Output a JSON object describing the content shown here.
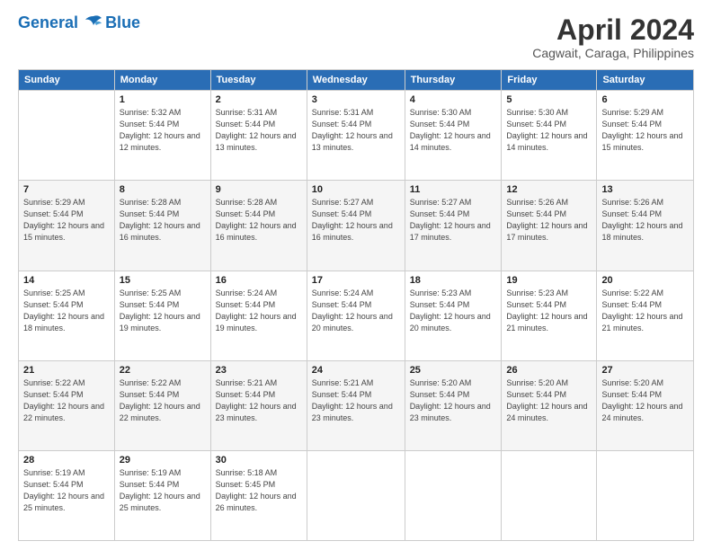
{
  "header": {
    "logo_line1": "General",
    "logo_line2": "Blue",
    "month": "April 2024",
    "location": "Cagwait, Caraga, Philippines"
  },
  "columns": [
    "Sunday",
    "Monday",
    "Tuesday",
    "Wednesday",
    "Thursday",
    "Friday",
    "Saturday"
  ],
  "weeks": [
    [
      {
        "day": "",
        "sunrise": "",
        "sunset": "",
        "daylight": ""
      },
      {
        "day": "1",
        "sunrise": "Sunrise: 5:32 AM",
        "sunset": "Sunset: 5:44 PM",
        "daylight": "Daylight: 12 hours and 12 minutes."
      },
      {
        "day": "2",
        "sunrise": "Sunrise: 5:31 AM",
        "sunset": "Sunset: 5:44 PM",
        "daylight": "Daylight: 12 hours and 13 minutes."
      },
      {
        "day": "3",
        "sunrise": "Sunrise: 5:31 AM",
        "sunset": "Sunset: 5:44 PM",
        "daylight": "Daylight: 12 hours and 13 minutes."
      },
      {
        "day": "4",
        "sunrise": "Sunrise: 5:30 AM",
        "sunset": "Sunset: 5:44 PM",
        "daylight": "Daylight: 12 hours and 14 minutes."
      },
      {
        "day": "5",
        "sunrise": "Sunrise: 5:30 AM",
        "sunset": "Sunset: 5:44 PM",
        "daylight": "Daylight: 12 hours and 14 minutes."
      },
      {
        "day": "6",
        "sunrise": "Sunrise: 5:29 AM",
        "sunset": "Sunset: 5:44 PM",
        "daylight": "Daylight: 12 hours and 15 minutes."
      }
    ],
    [
      {
        "day": "7",
        "sunrise": "Sunrise: 5:29 AM",
        "sunset": "Sunset: 5:44 PM",
        "daylight": "Daylight: 12 hours and 15 minutes."
      },
      {
        "day": "8",
        "sunrise": "Sunrise: 5:28 AM",
        "sunset": "Sunset: 5:44 PM",
        "daylight": "Daylight: 12 hours and 16 minutes."
      },
      {
        "day": "9",
        "sunrise": "Sunrise: 5:28 AM",
        "sunset": "Sunset: 5:44 PM",
        "daylight": "Daylight: 12 hours and 16 minutes."
      },
      {
        "day": "10",
        "sunrise": "Sunrise: 5:27 AM",
        "sunset": "Sunset: 5:44 PM",
        "daylight": "Daylight: 12 hours and 16 minutes."
      },
      {
        "day": "11",
        "sunrise": "Sunrise: 5:27 AM",
        "sunset": "Sunset: 5:44 PM",
        "daylight": "Daylight: 12 hours and 17 minutes."
      },
      {
        "day": "12",
        "sunrise": "Sunrise: 5:26 AM",
        "sunset": "Sunset: 5:44 PM",
        "daylight": "Daylight: 12 hours and 17 minutes."
      },
      {
        "day": "13",
        "sunrise": "Sunrise: 5:26 AM",
        "sunset": "Sunset: 5:44 PM",
        "daylight": "Daylight: 12 hours and 18 minutes."
      }
    ],
    [
      {
        "day": "14",
        "sunrise": "Sunrise: 5:25 AM",
        "sunset": "Sunset: 5:44 PM",
        "daylight": "Daylight: 12 hours and 18 minutes."
      },
      {
        "day": "15",
        "sunrise": "Sunrise: 5:25 AM",
        "sunset": "Sunset: 5:44 PM",
        "daylight": "Daylight: 12 hours and 19 minutes."
      },
      {
        "day": "16",
        "sunrise": "Sunrise: 5:24 AM",
        "sunset": "Sunset: 5:44 PM",
        "daylight": "Daylight: 12 hours and 19 minutes."
      },
      {
        "day": "17",
        "sunrise": "Sunrise: 5:24 AM",
        "sunset": "Sunset: 5:44 PM",
        "daylight": "Daylight: 12 hours and 20 minutes."
      },
      {
        "day": "18",
        "sunrise": "Sunrise: 5:23 AM",
        "sunset": "Sunset: 5:44 PM",
        "daylight": "Daylight: 12 hours and 20 minutes."
      },
      {
        "day": "19",
        "sunrise": "Sunrise: 5:23 AM",
        "sunset": "Sunset: 5:44 PM",
        "daylight": "Daylight: 12 hours and 21 minutes."
      },
      {
        "day": "20",
        "sunrise": "Sunrise: 5:22 AM",
        "sunset": "Sunset: 5:44 PM",
        "daylight": "Daylight: 12 hours and 21 minutes."
      }
    ],
    [
      {
        "day": "21",
        "sunrise": "Sunrise: 5:22 AM",
        "sunset": "Sunset: 5:44 PM",
        "daylight": "Daylight: 12 hours and 22 minutes."
      },
      {
        "day": "22",
        "sunrise": "Sunrise: 5:22 AM",
        "sunset": "Sunset: 5:44 PM",
        "daylight": "Daylight: 12 hours and 22 minutes."
      },
      {
        "day": "23",
        "sunrise": "Sunrise: 5:21 AM",
        "sunset": "Sunset: 5:44 PM",
        "daylight": "Daylight: 12 hours and 23 minutes."
      },
      {
        "day": "24",
        "sunrise": "Sunrise: 5:21 AM",
        "sunset": "Sunset: 5:44 PM",
        "daylight": "Daylight: 12 hours and 23 minutes."
      },
      {
        "day": "25",
        "sunrise": "Sunrise: 5:20 AM",
        "sunset": "Sunset: 5:44 PM",
        "daylight": "Daylight: 12 hours and 23 minutes."
      },
      {
        "day": "26",
        "sunrise": "Sunrise: 5:20 AM",
        "sunset": "Sunset: 5:44 PM",
        "daylight": "Daylight: 12 hours and 24 minutes."
      },
      {
        "day": "27",
        "sunrise": "Sunrise: 5:20 AM",
        "sunset": "Sunset: 5:44 PM",
        "daylight": "Daylight: 12 hours and 24 minutes."
      }
    ],
    [
      {
        "day": "28",
        "sunrise": "Sunrise: 5:19 AM",
        "sunset": "Sunset: 5:44 PM",
        "daylight": "Daylight: 12 hours and 25 minutes."
      },
      {
        "day": "29",
        "sunrise": "Sunrise: 5:19 AM",
        "sunset": "Sunset: 5:44 PM",
        "daylight": "Daylight: 12 hours and 25 minutes."
      },
      {
        "day": "30",
        "sunrise": "Sunrise: 5:18 AM",
        "sunset": "Sunset: 5:45 PM",
        "daylight": "Daylight: 12 hours and 26 minutes."
      },
      {
        "day": "",
        "sunrise": "",
        "sunset": "",
        "daylight": ""
      },
      {
        "day": "",
        "sunrise": "",
        "sunset": "",
        "daylight": ""
      },
      {
        "day": "",
        "sunrise": "",
        "sunset": "",
        "daylight": ""
      },
      {
        "day": "",
        "sunrise": "",
        "sunset": "",
        "daylight": ""
      }
    ]
  ]
}
